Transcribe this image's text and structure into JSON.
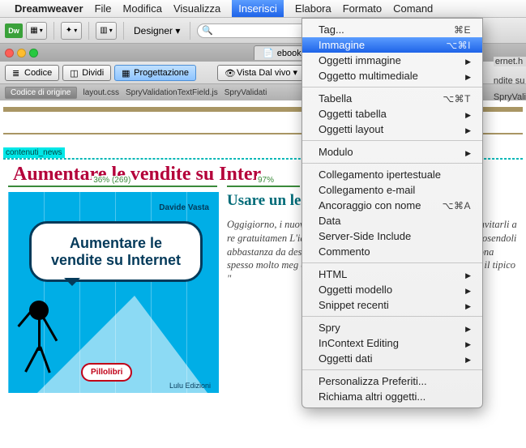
{
  "menubar": {
    "app": "Dreamweaver",
    "items": [
      "File",
      "Modifica",
      "Visualizza",
      "Inserisci",
      "Elabora",
      "Formato",
      "Comand"
    ],
    "active_index": 3
  },
  "toolbar": {
    "logo": "Dw",
    "designer_label": "Designer"
  },
  "doctabs": {
    "tab1": "ebook_a"
  },
  "right_fragment": {
    "line1": "ernet.h",
    "line2": "ndite su",
    "line3": "SpryVali"
  },
  "viewbar": {
    "codice": "Codice",
    "dividi": "Dividi",
    "progettazione": "Progettazione",
    "vista_dal_vivo": "Vista Dal vivo"
  },
  "filetabs": {
    "source": "Codice di origine",
    "files": [
      "layout.css",
      "SpryValidationTextField.js",
      "SpryValidati"
    ]
  },
  "canvas": {
    "tag_label": "contenuti_news",
    "page_title": "Aumentare le vendite su Inter",
    "measure1": "36% (269)",
    "measure2": "97%",
    "cover_author": "Davide Vasta",
    "cover_title_line1": "Aumentare le",
    "cover_title_line2": "vendite su Internet",
    "pill_label": "Pillolibri",
    "lulu": "Lulu Edizioni",
    "article_title": "Usare un\nle vendit",
    "article_body": "Oggigiorno, i\nnuove strat\neffettuare\ncome? Invec\nche gli uten\ninvitarli a re\ngratuitamen\nL'idea che si\nè di mostra\nmodo graduale, incuriosendoli abbastanza da desiderare di\nfare l'acquisto. Tale metodo funziona spesso molto meg\nche avviene tradizionalmente nel commercio il tipico \""
  },
  "dropdown": {
    "items": [
      {
        "label": "Tag...",
        "shortcut": "⌘E"
      },
      {
        "label": "Immagine",
        "shortcut": "⌥⌘I",
        "highlight": true
      },
      {
        "label": "Oggetti immagine",
        "submenu": true
      },
      {
        "label": "Oggetto multimediale",
        "submenu": true
      },
      {
        "sep": true
      },
      {
        "label": "Tabella",
        "shortcut": "⌥⌘T"
      },
      {
        "label": "Oggetti tabella",
        "submenu": true
      },
      {
        "label": "Oggetti layout",
        "submenu": true
      },
      {
        "sep": true
      },
      {
        "label": "Modulo",
        "submenu": true
      },
      {
        "sep": true
      },
      {
        "label": "Collegamento ipertestuale"
      },
      {
        "label": "Collegamento e-mail"
      },
      {
        "label": "Ancoraggio con nome",
        "shortcut": "⌥⌘A"
      },
      {
        "label": "Data"
      },
      {
        "label": "Server-Side Include"
      },
      {
        "label": "Commento"
      },
      {
        "sep": true
      },
      {
        "label": "HTML",
        "submenu": true
      },
      {
        "label": "Oggetti modello",
        "submenu": true
      },
      {
        "label": "Snippet recenti",
        "submenu": true
      },
      {
        "sep": true
      },
      {
        "label": "Spry",
        "submenu": true
      },
      {
        "label": "InContext Editing",
        "submenu": true
      },
      {
        "label": "Oggetti dati",
        "submenu": true
      },
      {
        "sep": true
      },
      {
        "label": "Personalizza Preferiti..."
      },
      {
        "label": "Richiama altri oggetti..."
      }
    ]
  }
}
